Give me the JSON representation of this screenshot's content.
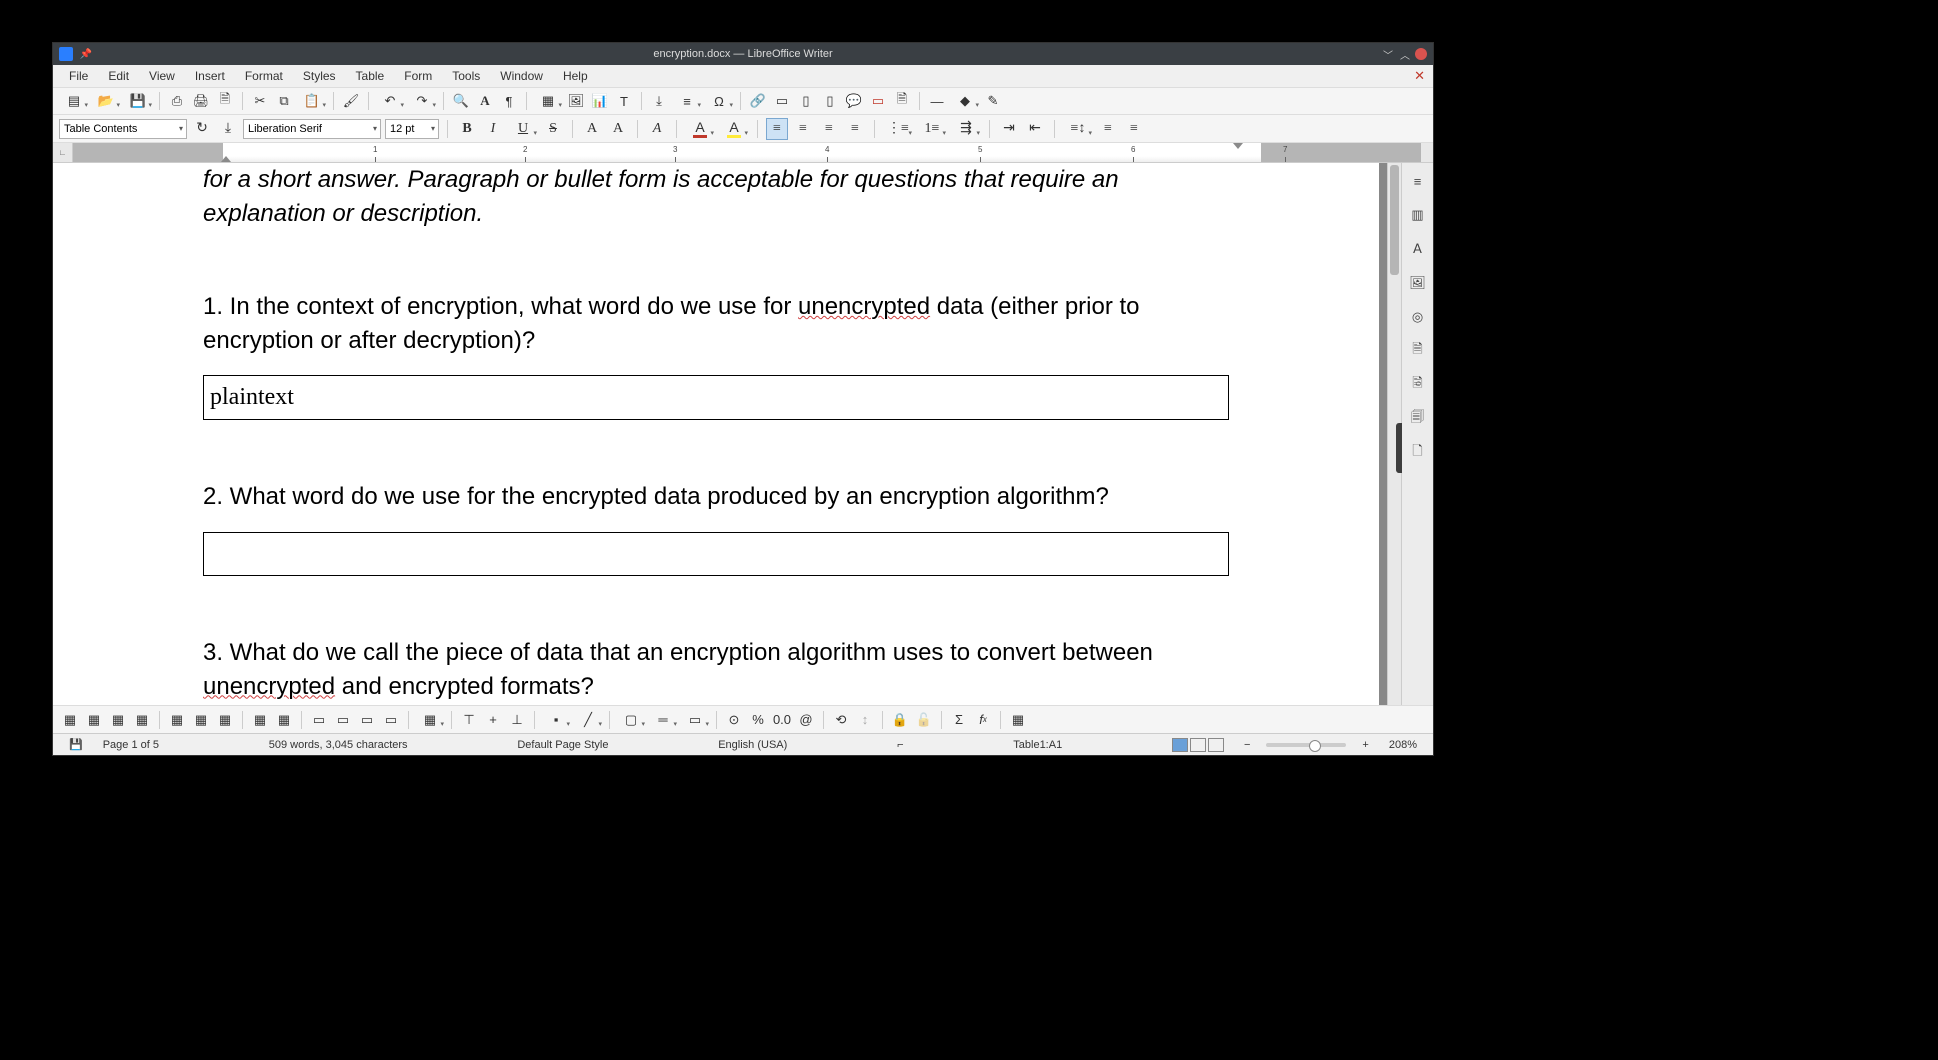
{
  "window": {
    "title": "encryption.docx — LibreOffice Writer"
  },
  "menus": [
    "File",
    "Edit",
    "View",
    "Insert",
    "Format",
    "Styles",
    "Table",
    "Form",
    "Tools",
    "Window",
    "Help"
  ],
  "format": {
    "paragraph_style": "Table Contents",
    "font_name": "Liberation Serif",
    "font_size": "12 pt"
  },
  "ruler": {
    "ticks": [
      "1",
      "2",
      "3",
      "4",
      "5",
      "6",
      "7"
    ]
  },
  "document": {
    "intro_fragment": "for a short answer. Paragraph or bullet form is acceptable for questions that require an explanation or description.",
    "q1_pre": "1. In the context of encryption, what word do we use for ",
    "q1_spell": "unencrypted",
    "q1_post": " data (either prior to encryption or after decryption)?",
    "a1": "plaintext",
    "q2": "2. What word do we use for the encrypted data produced by an encryption algorithm?",
    "a2": "",
    "q3_pre": "3. What do we call the piece of data that an encryption algorithm uses to convert between ",
    "q3_spell": "unencrypted",
    "q3_post": " and encrypted formats?"
  },
  "status": {
    "save_icon": "💾",
    "page": "Page 1 of 5",
    "words": "509 words, 3,045 characters",
    "page_style": "Default Page Style",
    "language": "English (USA)",
    "insert_mode": "",
    "selection_mode": "⌐",
    "table_cell": "Table1:A1",
    "zoom_minus": "−",
    "zoom_plus": "+",
    "zoom": "208%"
  }
}
